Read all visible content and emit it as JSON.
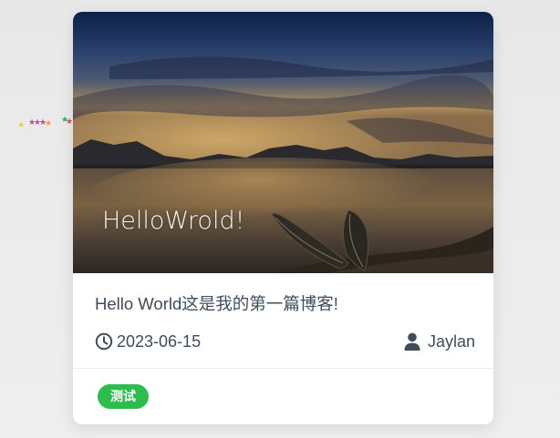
{
  "post": {
    "cover_text": "HelloWrold!",
    "title": "Hello World这是我的第一篇博客!",
    "date": "2023-06-15",
    "author": "Jaylan",
    "tags": [
      "测试"
    ]
  },
  "icons": {
    "date_icon": "clock-icon",
    "author_icon": "user-icon"
  },
  "colors": {
    "tag_background": "#2dbc4e",
    "text": "#3e4d5c",
    "card_background": "#ffffff"
  }
}
